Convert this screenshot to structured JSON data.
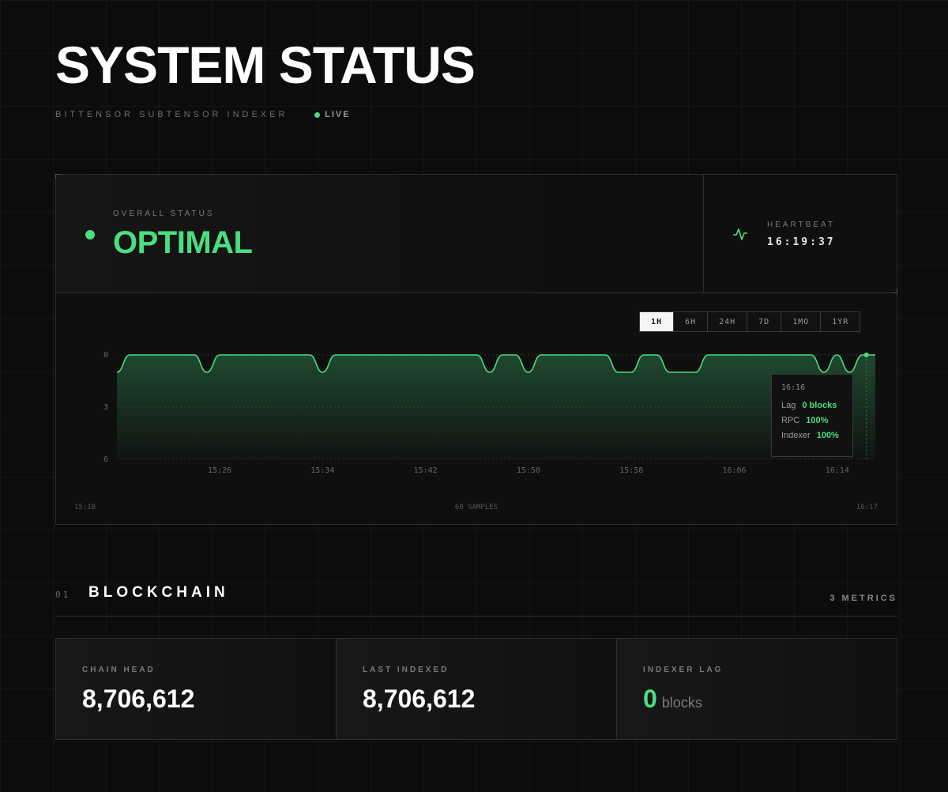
{
  "header": {
    "title": "SYSTEM STATUS",
    "subtitle": "BITTENSOR SUBTENSOR INDEXER",
    "separator": "·",
    "live_label": "LIVE"
  },
  "overall": {
    "label": "OVERALL STATUS",
    "value": "OPTIMAL"
  },
  "heartbeat": {
    "label": "HEARTBEAT",
    "value": "16:19:37",
    "icon": "pulse-icon"
  },
  "range_tabs": [
    {
      "label": "1H",
      "active": true
    },
    {
      "label": "6H",
      "active": false
    },
    {
      "label": "24H",
      "active": false
    },
    {
      "label": "7D",
      "active": false
    },
    {
      "label": "1MO",
      "active": false
    },
    {
      "label": "1YR",
      "active": false
    }
  ],
  "chart_data": {
    "type": "area",
    "y_ticks": [
      "0",
      "3",
      "6"
    ],
    "ylim": [
      6,
      0
    ],
    "x_ticks": [
      "15:26",
      "15:34",
      "15:42",
      "15:50",
      "15:58",
      "16:06",
      "16:14"
    ],
    "footer_left": "15:18",
    "footer_center": "60 SAMPLES",
    "footer_right": "16:17",
    "values": [
      1,
      0,
      0,
      0,
      0,
      0,
      0,
      1,
      0,
      0,
      0,
      0,
      0,
      0,
      0,
      0,
      1,
      0,
      0,
      0,
      0,
      0,
      0,
      0,
      0,
      0,
      0,
      0,
      0,
      1,
      0,
      0,
      1,
      0,
      0,
      0,
      0,
      0,
      0,
      1,
      1,
      0,
      0,
      1,
      1,
      1,
      0,
      0,
      0,
      0,
      0,
      0,
      0,
      0,
      0,
      1,
      0,
      1,
      0,
      0
    ],
    "color": "#4ade80",
    "grid": true
  },
  "tooltip": {
    "time": "16:16",
    "rows": [
      {
        "label": "Lag",
        "value": "0 blocks"
      },
      {
        "label": "RPC",
        "value": "100%"
      },
      {
        "label": "Indexer",
        "value": "100%"
      }
    ]
  },
  "section": {
    "number": "01",
    "title": "BLOCKCHAIN",
    "count": "3 METRICS"
  },
  "metrics": [
    {
      "label": "CHAIN HEAD",
      "value": "8,706,612",
      "unit": ""
    },
    {
      "label": "LAST INDEXED",
      "value": "8,706,612",
      "unit": ""
    },
    {
      "label": "INDEXER LAG",
      "value": "0",
      "unit": "blocks"
    }
  ],
  "colors": {
    "accent": "#4ade80",
    "background": "#0c0c0c"
  }
}
